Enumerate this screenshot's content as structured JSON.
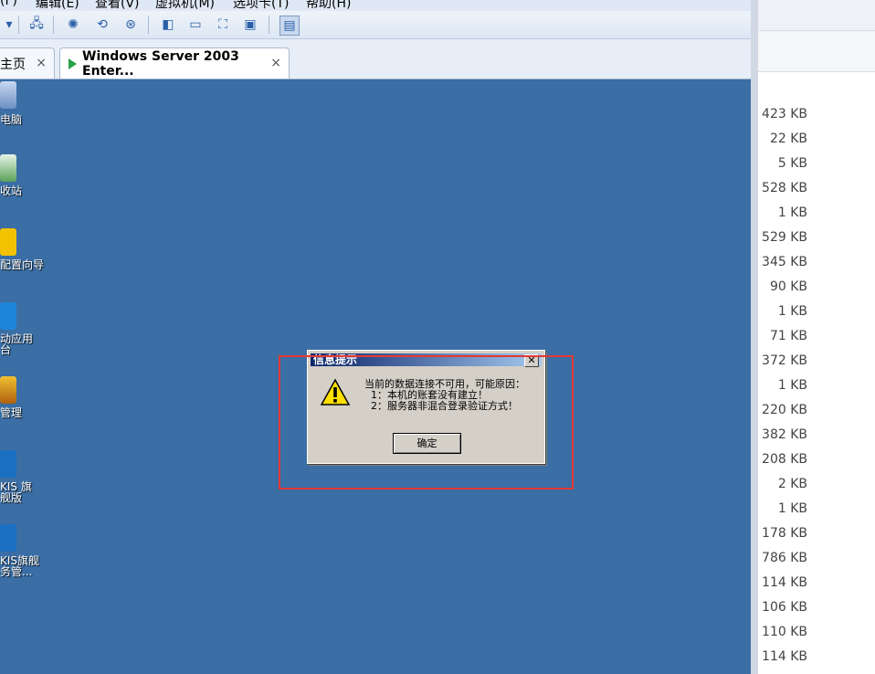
{
  "menu": [
    "(F)",
    "编辑(E)",
    "查看(V)",
    "虚拟机(M)",
    "选项卡(T)",
    "帮助(H)"
  ],
  "tabs": [
    {
      "label": "主页",
      "close": "×"
    },
    {
      "label": "Windows Server 2003 Enter...",
      "close": "×"
    }
  ],
  "desktop_icons": [
    {
      "label": "电脑",
      "icon": "computer-icon"
    },
    {
      "label": "收站",
      "icon": "recycle-bin-icon"
    },
    {
      "label": "配置向导",
      "icon": "wizard-icon"
    },
    {
      "label": "动应用\n台",
      "icon": "cloud-app-icon"
    },
    {
      "label": "管理",
      "icon": "management-icon"
    },
    {
      "label": "KIS 旗\n舰版",
      "icon": "kis-icon"
    },
    {
      "label": "KIS旗舰\n务管...",
      "icon": "kis-icon"
    }
  ],
  "dialog": {
    "title": "信息提示",
    "close": "✕",
    "message": "当前的数据连接不可用，可能原因：\n  1：本机的账套没有建立！\n  2：服务器非混合登录验证方式！",
    "ok_label": "确定",
    "icon": "warning-icon"
  },
  "file_sizes": [
    "423 KB",
    "22 KB",
    "5 KB",
    "528 KB",
    "1 KB",
    "529 KB",
    "345 KB",
    "90 KB",
    "1 KB",
    "71 KB",
    "372 KB",
    "1 KB",
    "220 KB",
    "382 KB",
    "208 KB",
    "2 KB",
    "1 KB",
    "178 KB",
    "786 KB",
    "114 KB",
    "106 KB",
    "110 KB",
    "114 KB"
  ],
  "colors": {
    "desktop": "#3a6ea5",
    "highlight": "#e53935"
  }
}
